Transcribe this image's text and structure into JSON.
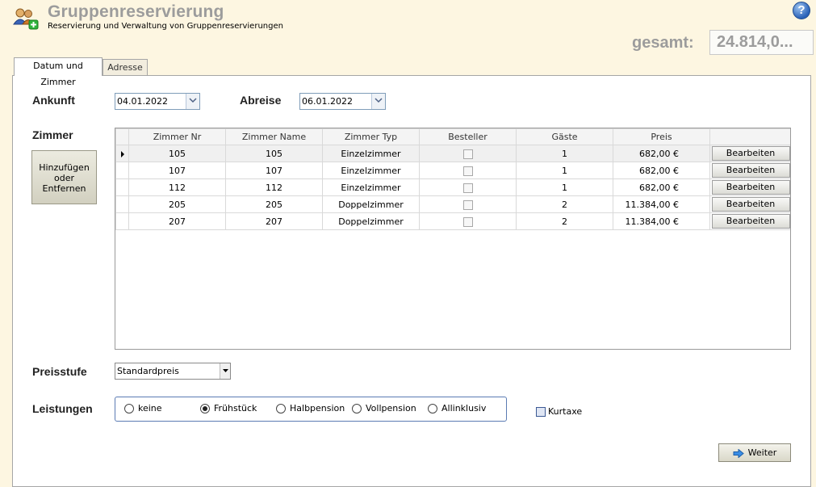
{
  "header": {
    "title": "Gruppenreservierung",
    "subtitle": "Reservierung und Verwaltung von Gruppenreservierungen",
    "help_icon": "?",
    "total_label": "gesamt:",
    "total_value": "24.814,0..."
  },
  "tabs": [
    {
      "label": "Datum und Zimmer",
      "active": true
    },
    {
      "label": "Adresse",
      "active": false
    }
  ],
  "form": {
    "arrival_label": "Ankunft",
    "arrival_value": "04.01.2022",
    "departure_label": "Abreise",
    "departure_value": "06.01.2022",
    "rooms_label": "Zimmer",
    "add_remove_line1": "Hinzufügen",
    "add_remove_line2": "oder",
    "add_remove_line3": "Entfernen",
    "price_level_label": "Preisstufe",
    "price_level_value": "Standardpreis",
    "services_label": "Leistungen",
    "services_options": [
      "keine",
      "Frühstück",
      "Halbpension",
      "Vollpension",
      "Allinklusiv"
    ],
    "services_selected": "Frühstück",
    "kurtaxe_label": "Kurtaxe",
    "next_label": "Weiter"
  },
  "grid": {
    "columns": [
      "Zimmer Nr",
      "Zimmer Name",
      "Zimmer Typ",
      "Besteller",
      "Gäste",
      "Preis"
    ],
    "edit_label": "Bearbeiten",
    "rows": [
      {
        "nr": "105",
        "name": "105",
        "type": "Einzelzimmer",
        "guests": "1",
        "price": "682,00 €"
      },
      {
        "nr": "107",
        "name": "107",
        "type": "Einzelzimmer",
        "guests": "1",
        "price": "682,00 €"
      },
      {
        "nr": "112",
        "name": "112",
        "type": "Einzelzimmer",
        "guests": "1",
        "price": "682,00 €"
      },
      {
        "nr": "205",
        "name": "205",
        "type": "Doppelzimmer",
        "guests": "2",
        "price": "11.384,00 €"
      },
      {
        "nr": "207",
        "name": "207",
        "type": "Doppelzimmer",
        "guests": "2",
        "price": "11.384,00 €"
      }
    ]
  },
  "colors": {
    "background": "#fdf6e1",
    "title_gray": "#9c9c9c",
    "radio_border": "#5b7bb3"
  }
}
